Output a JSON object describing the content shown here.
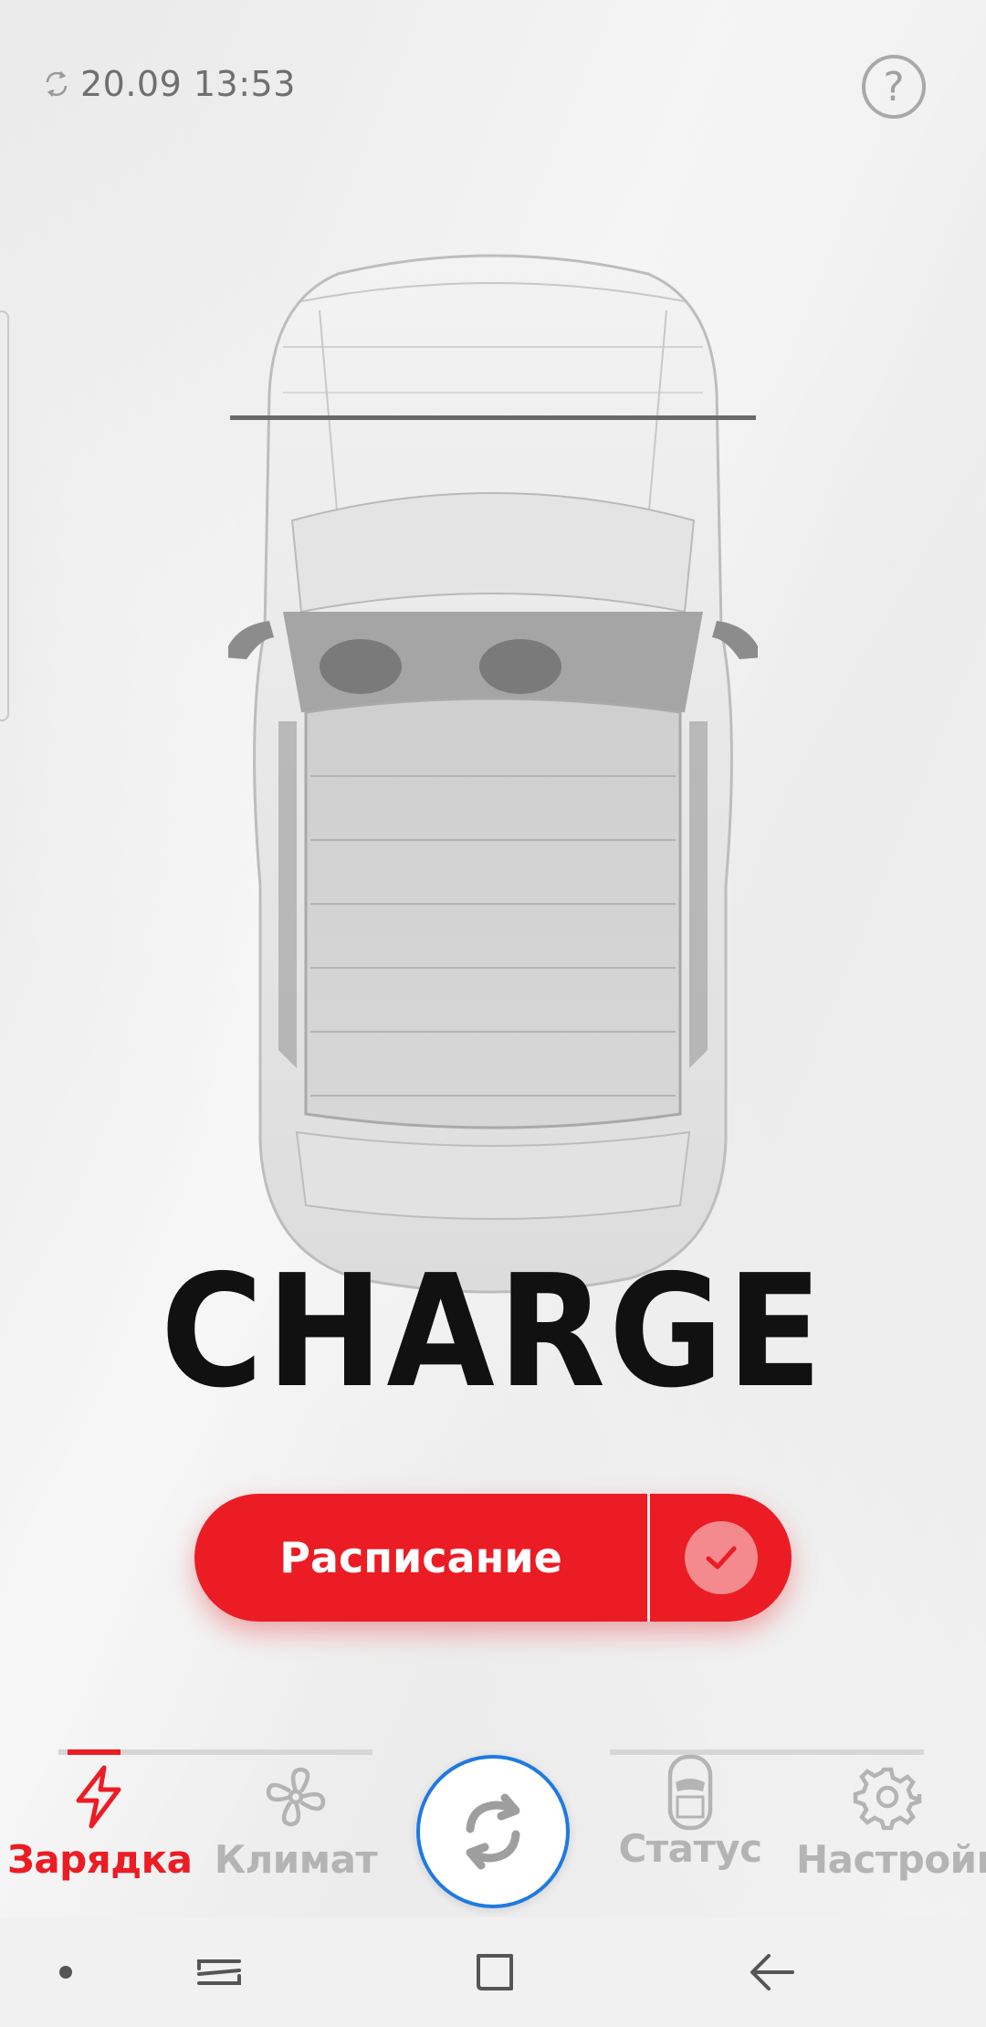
{
  "status": {
    "sync_time": "20.09 13:53",
    "help_symbol": "?"
  },
  "hero": {
    "title": "CHARGE"
  },
  "schedule": {
    "label": "Расписание",
    "enabled": true
  },
  "bottom_nav": {
    "items": [
      {
        "label": "Зарядка",
        "icon": "lightning-icon",
        "active": true
      },
      {
        "label": "Климат",
        "icon": "fan-icon",
        "active": false
      },
      {
        "label": "Статус",
        "icon": "car-status-icon",
        "active": false
      },
      {
        "label": "Настройки",
        "icon": "gear-icon",
        "active": false
      }
    ],
    "center_icon": "refresh-icon"
  },
  "colors": {
    "accent": "#ec1c24",
    "refresh_ring": "#1f7ae0",
    "inactive": "#b4b4b4"
  }
}
